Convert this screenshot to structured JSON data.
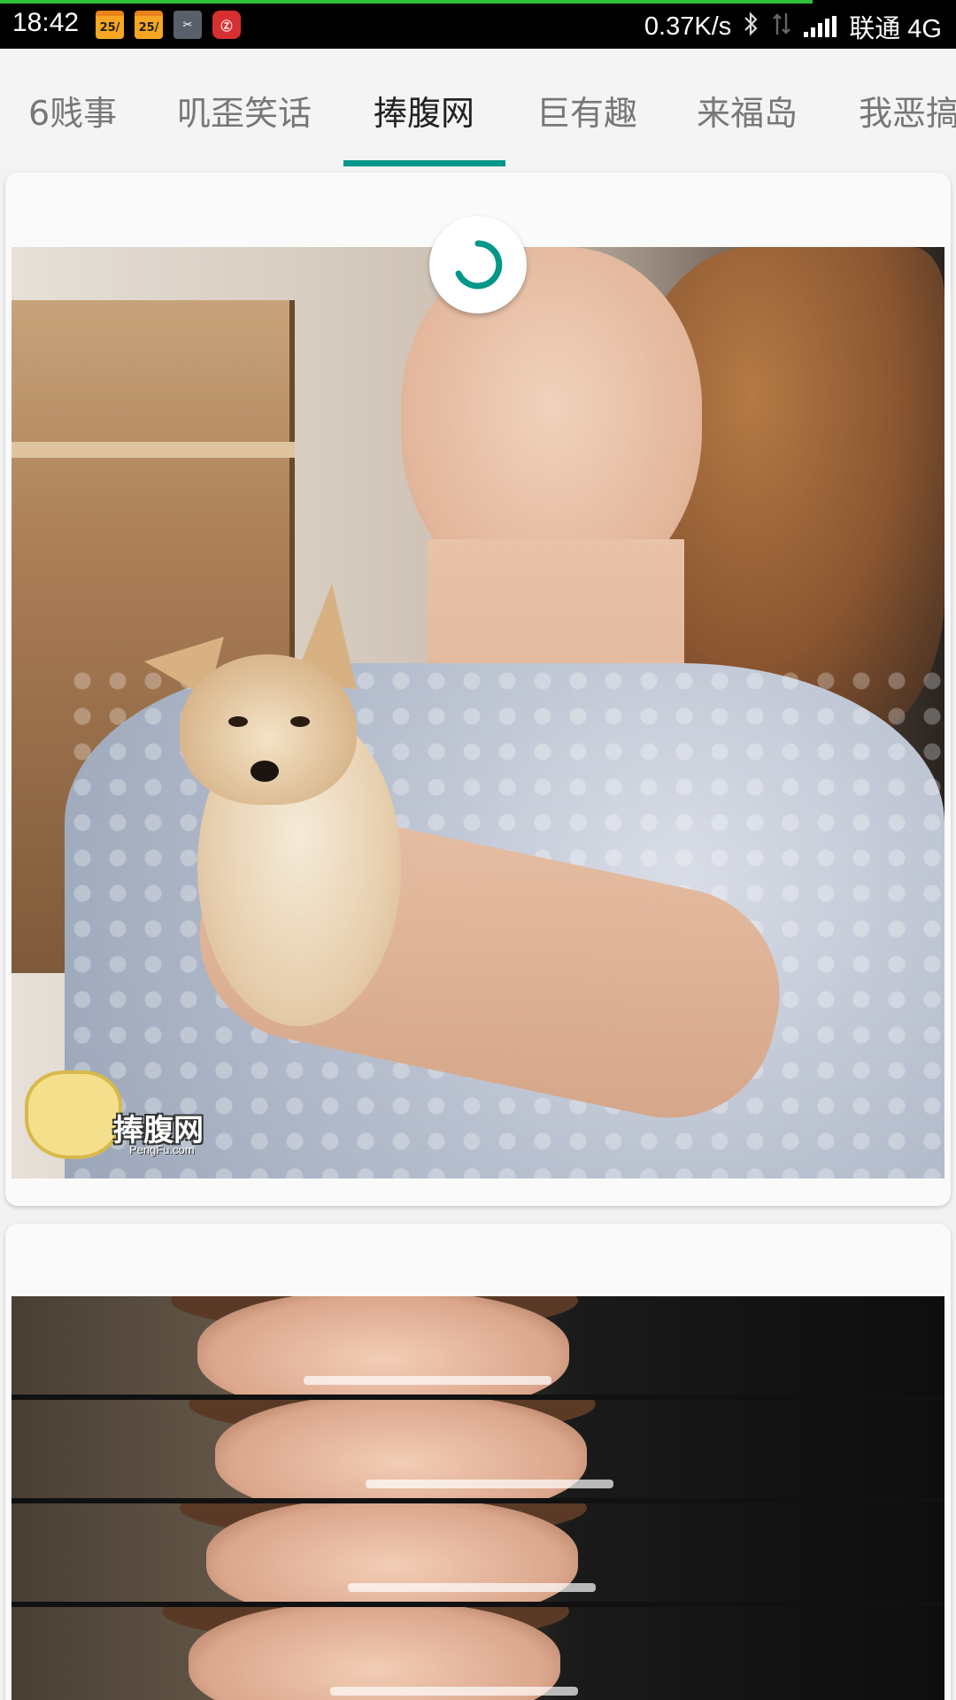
{
  "status_bar": {
    "time": "18:42",
    "notifications": [
      {
        "icon": "calendar-icon",
        "label": "25/"
      },
      {
        "icon": "calendar-icon",
        "label": "25/"
      },
      {
        "icon": "scissors-app-icon",
        "label": "✂"
      },
      {
        "icon": "red-app-icon",
        "label": "Ⓩ"
      }
    ],
    "net_speed": "0.37K/s",
    "carrier": "联通 4G",
    "page_load_progress": 0.85
  },
  "tabs": [
    {
      "label": "6贱事",
      "active": false
    },
    {
      "label": "叽歪笑话",
      "active": false
    },
    {
      "label": "捧腹网",
      "active": true
    },
    {
      "label": "巨有趣",
      "active": false
    },
    {
      "label": "来福岛",
      "active": false
    },
    {
      "label": "我恶搞",
      "active": false
    }
  ],
  "feed": {
    "post1": {
      "image_desc": "woman-holding-chihuahua",
      "watermark_text": "捧腹网",
      "watermark_sub": "PengFu.com"
    },
    "post2": {
      "image_desc": "stacked-video-frames",
      "frames": 4
    }
  },
  "colors": {
    "accent": "#009688",
    "status_bar": "#000000",
    "progress": "#2ec13b",
    "background": "#f2f2f2"
  }
}
